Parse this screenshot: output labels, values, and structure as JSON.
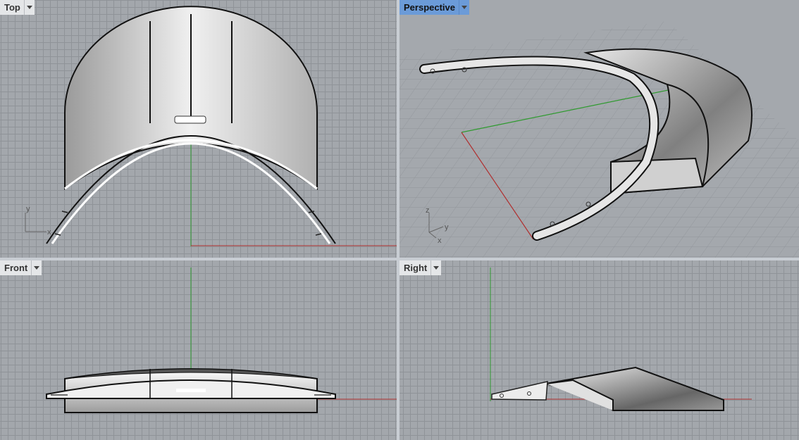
{
  "viewports": {
    "top": {
      "label": "Top"
    },
    "perspective": {
      "label": "Perspective"
    },
    "front": {
      "label": "Front"
    },
    "right": {
      "label": "Right"
    }
  },
  "axes": {
    "x": "x",
    "y": "y",
    "z": "z"
  },
  "colors": {
    "grid": "#8f9398",
    "background": "#a3a7ac",
    "active_label": "#6b9bd8",
    "x_axis": "#b03030",
    "y_axis": "#2f9a2f"
  }
}
